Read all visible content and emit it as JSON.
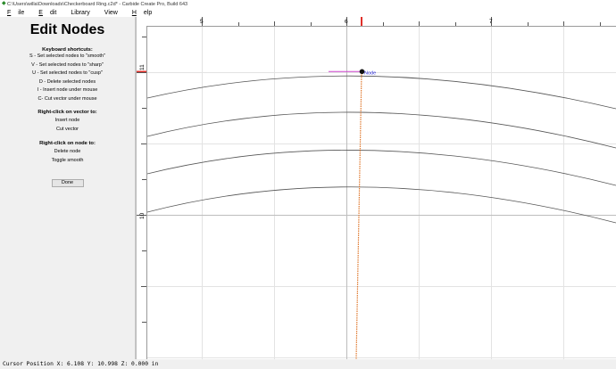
{
  "window": {
    "title": "C:\\Users\\willa\\Downloads\\Checkerboard Ring.c2d* - Carbide Create Pro, Build 643"
  },
  "menu": [
    {
      "label": "File",
      "key": "F",
      "rest": "ile"
    },
    {
      "label": "Edit",
      "key": "E",
      "rest": "dit"
    },
    {
      "label": "Library",
      "key": "",
      "rest": "Library"
    },
    {
      "label": "View",
      "key": "",
      "rest": "View"
    },
    {
      "label": "Help",
      "key": "H",
      "rest": "elp"
    }
  ],
  "panel": {
    "title": "Edit Nodes",
    "shortcuts_title": "Keyboard shortcuts:",
    "shortcuts": [
      "S - Set selected nodes to \"smooth\"",
      "V - Set selected nodes to \"sharp\"",
      "U - Set selected nodes to \"cusp\"",
      "D - Delete selected nodes",
      "I - Insert node under mouse",
      "C- Cut vector under mouse"
    ],
    "vector_title": "Right-click on vector to:",
    "vector_actions": [
      "Insert node",
      "Cut vector"
    ],
    "node_title": "Right-click on node to:",
    "node_actions": [
      "Delete node",
      "Toggle smooth"
    ],
    "done_label": "Done"
  },
  "ruler": {
    "top_labels": [
      "5",
      "6",
      "7"
    ],
    "left_labels": [
      "11",
      "10"
    ]
  },
  "canvas": {
    "node_label": "Node"
  },
  "colors": {
    "cursor_line": "#e0302a",
    "node_label": "#2b2bd6",
    "handle": "#cc44cc",
    "curve": "#555555",
    "grid": "#e3e3e3"
  },
  "status": {
    "text": "Cursor Position X: 6.108 Y: 10.998 Z: 0.000 in"
  }
}
